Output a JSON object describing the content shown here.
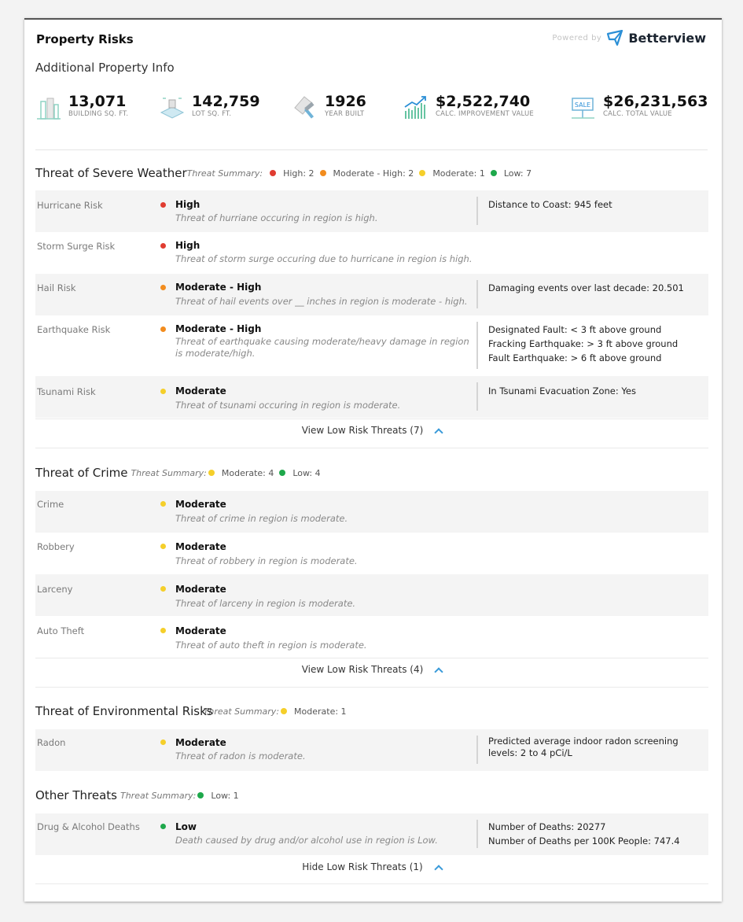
{
  "header": {
    "title": "Property Risks",
    "powered_by": "Powered by",
    "brand": "Betterview"
  },
  "info": {
    "title": "Additional Property Info",
    "stats": [
      {
        "value": "13,071",
        "label": "BUILDING SQ. FT.",
        "icon": "building-icon"
      },
      {
        "value": "142,759",
        "label": "LOT SQ. FT.",
        "icon": "lot-icon"
      },
      {
        "value": "1926",
        "label": "YEAR BUILT",
        "icon": "hammer-icon"
      },
      {
        "value": "$2,522,740",
        "label": "CALC. IMPROVEMENT VALUE",
        "icon": "growth-chart-icon"
      },
      {
        "value": "$26,231,563",
        "label": "CALC. TOTAL VALUE",
        "icon": "sale-sign-icon"
      }
    ]
  },
  "colors": {
    "high": "#e03c31",
    "mod_high": "#f28c1e",
    "moderate": "#f5cf2a",
    "low": "#1ea84b",
    "accent": "#3a9ad9"
  },
  "weather": {
    "title": "Threat of Severe Weather",
    "summary_label": "Threat Summary:",
    "summary": [
      "High: 2",
      "Moderate - High: 2",
      "Moderate: 1",
      "Low: 7"
    ],
    "rows": [
      {
        "name": "Hurricane Risk",
        "level": "High",
        "desc": "Threat of hurriane occuring in region is high.",
        "info": "Distance to Coast: 945 feet"
      },
      {
        "name": "Storm Surge Risk",
        "level": "High",
        "desc": "Threat of storm surge occuring due to hurricane in region is high.",
        "info": ""
      },
      {
        "name": "Hail Risk",
        "level": "Moderate - High",
        "desc": "Threat of hail events over __ inches in region is moderate - high.",
        "info": "Damaging events over last decade: 20.501"
      },
      {
        "name": "Earthquake Risk",
        "level": "Moderate - High",
        "desc": "Threat of earthquake causing moderate/heavy damage in region is moderate/high.",
        "info1": "Designated Fault: < 3 ft above ground",
        "info2": "Fracking Earthquake: > 3 ft above ground",
        "info3": "Fault Earthquake: > 6 ft above ground"
      },
      {
        "name": "Tsunami Risk",
        "level": "Moderate",
        "desc": "Threat of tsunami occuring in region is moderate.",
        "info": "In Tsunami Evacuation Zone: Yes"
      }
    ],
    "toggle": "View Low Risk Threats (7)"
  },
  "crime": {
    "title": "Threat of Crime",
    "summary_label": "Threat Summary:",
    "summary": [
      "Moderate: 4",
      "Low: 4"
    ],
    "rows": [
      {
        "name": "Crime",
        "level": "Moderate",
        "desc": "Threat of crime in region is moderate."
      },
      {
        "name": "Robbery",
        "level": "Moderate",
        "desc": "Threat of robbery in region is moderate."
      },
      {
        "name": "Larceny",
        "level": "Moderate",
        "desc": "Threat of larceny in region is moderate."
      },
      {
        "name": "Auto Theft",
        "level": "Moderate",
        "desc": "Threat of auto theft in region is moderate."
      }
    ],
    "toggle": "View Low Risk Threats (4)"
  },
  "environment": {
    "title": "Threat of Environmental Risks",
    "summary_label": "Threat Summary:",
    "summary": [
      "Moderate: 1"
    ],
    "rows": [
      {
        "name": "Radon",
        "level": "Moderate",
        "desc": "Threat of radon is moderate.",
        "info": "Predicted average indoor radon screening levels: 2 to 4 pCi/L"
      }
    ]
  },
  "other": {
    "title": "Other Threats",
    "summary_label": "Threat Summary:",
    "summary": [
      "Low: 1"
    ],
    "rows": [
      {
        "name": "Drug & Alcohol Deaths",
        "level": "Low",
        "desc": "Death caused by drug and/or alcohol use in region is Low.",
        "info1": "Number of Deaths: 20277",
        "info2": "Number of Deaths per 100K People: 747.4"
      }
    ],
    "toggle": "Hide Low Risk Threats (1)"
  }
}
